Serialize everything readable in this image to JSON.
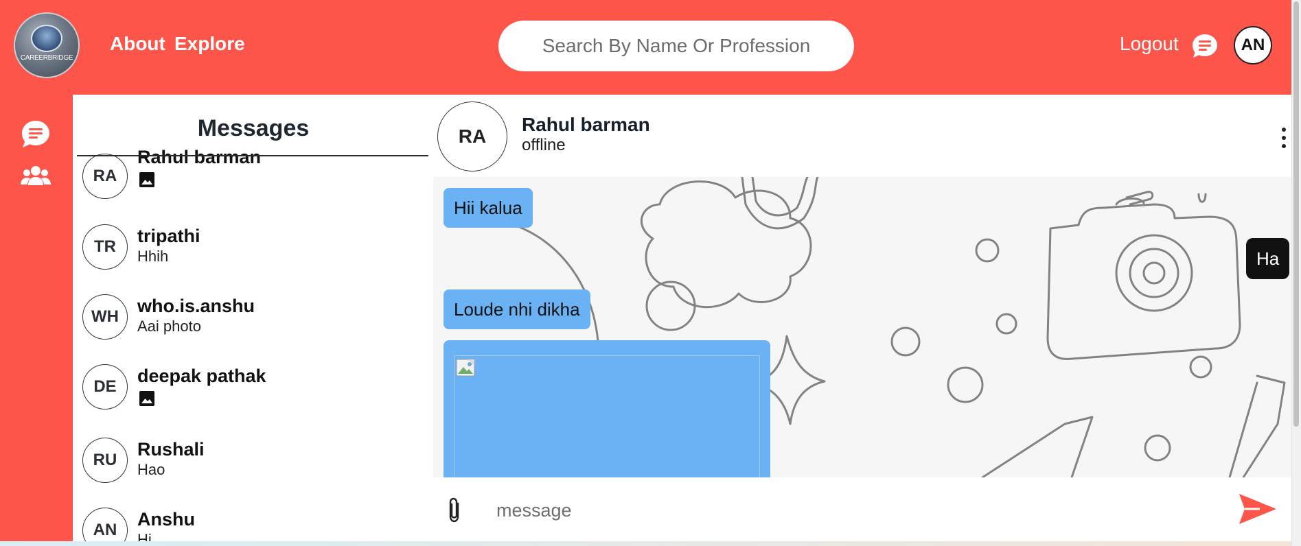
{
  "brand": {
    "logo_text": "CAREERBRIDGE"
  },
  "header": {
    "nav": {
      "about": "About",
      "explore": "Explore"
    },
    "search": {
      "placeholder": "Search By Name Or Profession"
    },
    "logout": "Logout",
    "user_initials": "AN"
  },
  "sidebar": {
    "title": "Messages",
    "conversations": [
      {
        "initials": "RA",
        "name": "Rahul barman",
        "preview": "",
        "preview_icon": "image-icon"
      },
      {
        "initials": "TR",
        "name": "tripathi",
        "preview": "Hhih"
      },
      {
        "initials": "WH",
        "name": "who.is.anshu",
        "preview": "Aai photo"
      },
      {
        "initials": "DE",
        "name": "deepak pathak",
        "preview": "",
        "preview_icon": "image-icon"
      },
      {
        "initials": "RU",
        "name": "Rushali",
        "preview": "Hao"
      },
      {
        "initials": "AN",
        "name": "Anshu",
        "preview": "Hi"
      }
    ]
  },
  "chat": {
    "contact": {
      "initials": "RA",
      "name": "Rahul barman",
      "status": "offline"
    },
    "messages": [
      {
        "direction": "in",
        "text": "Hii kalua"
      },
      {
        "direction": "out",
        "text": "Ha"
      },
      {
        "direction": "in",
        "text": "Loude nhi dikha"
      },
      {
        "direction": "in",
        "type": "image"
      }
    ],
    "composer": {
      "placeholder": "message"
    }
  },
  "colors": {
    "accent": "#fd5549",
    "incoming_bubble": "#6ab2f3",
    "outgoing_bubble": "#111111"
  },
  "icons": {
    "top_chat": "chat-bubble-icon",
    "rail": [
      "chat-bubble-icon",
      "people-icon"
    ],
    "attach": "paperclip-icon",
    "send": "send-icon",
    "menu": "kebab-menu-icon"
  }
}
